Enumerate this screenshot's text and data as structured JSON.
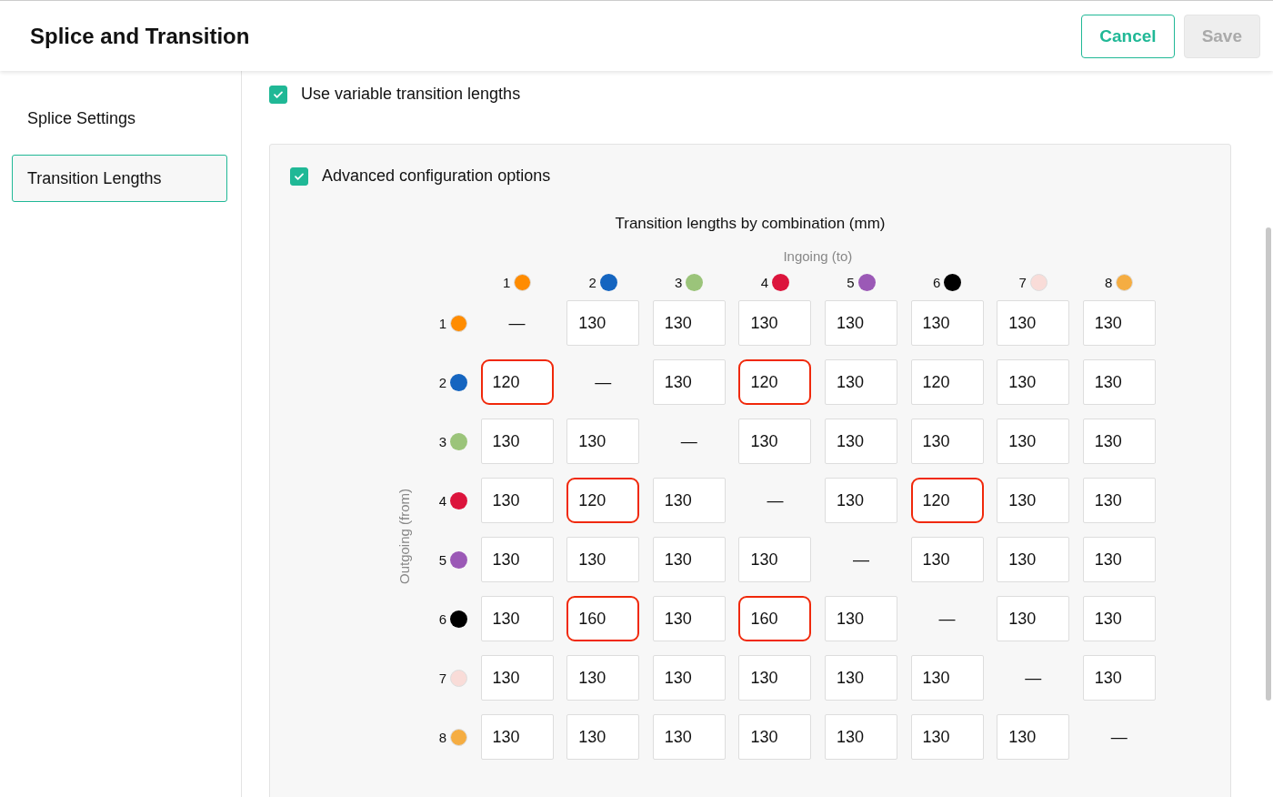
{
  "header": {
    "title": "Splice and Transition",
    "buttons": [
      {
        "label": "Cancel",
        "kind": "outline",
        "disabled": false
      },
      {
        "label": "Save",
        "kind": "primary",
        "disabled": true
      }
    ]
  },
  "sidebar": {
    "items": [
      {
        "label": "Splice Settings",
        "selected": false
      },
      {
        "label": "Transition Lengths",
        "selected": true
      }
    ]
  },
  "variable_lengths": {
    "label": "Use variable transition lengths",
    "checked": true
  },
  "advanced": {
    "label": "Advanced configuration options",
    "checked": true
  },
  "matrix": {
    "title": "Transition lengths by combination (mm)",
    "column_axis": "Ingoing (to)",
    "row_axis": "Outgoing (from)",
    "columns": [
      {
        "label": "1",
        "color": "#ff8c00"
      },
      {
        "label": "2",
        "color": "#1565c0"
      },
      {
        "label": "3",
        "color": "#9bc47a"
      },
      {
        "label": "4",
        "color": "#dc143c"
      },
      {
        "label": "5",
        "color": "#9b59b6"
      },
      {
        "label": "6",
        "color": "#000000"
      },
      {
        "label": "7",
        "color": "#f9dcd8"
      },
      {
        "label": "8",
        "color": "#f5ad42"
      }
    ],
    "rows": [
      {
        "label": "1",
        "color": "#ff8c00",
        "cells": [
          {
            "kind": "none",
            "text": "—"
          },
          {
            "kind": "input",
            "value": "130",
            "highlighted": false
          },
          {
            "kind": "input",
            "value": "130",
            "highlighted": false
          },
          {
            "kind": "input",
            "value": "130",
            "highlighted": false
          },
          {
            "kind": "input",
            "value": "130",
            "highlighted": false
          },
          {
            "kind": "input",
            "value": "130",
            "highlighted": false
          },
          {
            "kind": "input",
            "value": "130",
            "highlighted": false
          },
          {
            "kind": "input",
            "value": "130",
            "highlighted": false
          }
        ]
      },
      {
        "label": "2",
        "color": "#1565c0",
        "cells": [
          {
            "kind": "input",
            "value": "120",
            "highlighted": true
          },
          {
            "kind": "none",
            "text": "—"
          },
          {
            "kind": "input",
            "value": "130",
            "highlighted": false
          },
          {
            "kind": "input",
            "value": "120",
            "highlighted": true
          },
          {
            "kind": "input",
            "value": "130",
            "highlighted": false
          },
          {
            "kind": "input",
            "value": "120",
            "highlighted": false
          },
          {
            "kind": "input",
            "value": "130",
            "highlighted": false
          },
          {
            "kind": "input",
            "value": "130",
            "highlighted": false
          }
        ]
      },
      {
        "label": "3",
        "color": "#9bc47a",
        "cells": [
          {
            "kind": "input",
            "value": "130",
            "highlighted": false
          },
          {
            "kind": "input",
            "value": "130",
            "highlighted": false
          },
          {
            "kind": "none",
            "text": "—"
          },
          {
            "kind": "input",
            "value": "130",
            "highlighted": false
          },
          {
            "kind": "input",
            "value": "130",
            "highlighted": false
          },
          {
            "kind": "input",
            "value": "130",
            "highlighted": false
          },
          {
            "kind": "input",
            "value": "130",
            "highlighted": false
          },
          {
            "kind": "input",
            "value": "130",
            "highlighted": false
          }
        ]
      },
      {
        "label": "4",
        "color": "#dc143c",
        "cells": [
          {
            "kind": "input",
            "value": "130",
            "highlighted": false
          },
          {
            "kind": "input",
            "value": "120",
            "highlighted": true
          },
          {
            "kind": "input",
            "value": "130",
            "highlighted": false
          },
          {
            "kind": "none",
            "text": "—"
          },
          {
            "kind": "input",
            "value": "130",
            "highlighted": false
          },
          {
            "kind": "input",
            "value": "120",
            "highlighted": true
          },
          {
            "kind": "input",
            "value": "130",
            "highlighted": false
          },
          {
            "kind": "input",
            "value": "130",
            "highlighted": false
          }
        ]
      },
      {
        "label": "5",
        "color": "#9b59b6",
        "cells": [
          {
            "kind": "input",
            "value": "130",
            "highlighted": false
          },
          {
            "kind": "input",
            "value": "130",
            "highlighted": false
          },
          {
            "kind": "input",
            "value": "130",
            "highlighted": false
          },
          {
            "kind": "input",
            "value": "130",
            "highlighted": false
          },
          {
            "kind": "none",
            "text": "—"
          },
          {
            "kind": "input",
            "value": "130",
            "highlighted": false
          },
          {
            "kind": "input",
            "value": "130",
            "highlighted": false
          },
          {
            "kind": "input",
            "value": "130",
            "highlighted": false
          }
        ]
      },
      {
        "label": "6",
        "color": "#000000",
        "cells": [
          {
            "kind": "input",
            "value": "130",
            "highlighted": false
          },
          {
            "kind": "input",
            "value": "160",
            "highlighted": true
          },
          {
            "kind": "input",
            "value": "130",
            "highlighted": false
          },
          {
            "kind": "input",
            "value": "160",
            "highlighted": true
          },
          {
            "kind": "input",
            "value": "130",
            "highlighted": false
          },
          {
            "kind": "none",
            "text": "—"
          },
          {
            "kind": "input",
            "value": "130",
            "highlighted": false
          },
          {
            "kind": "input",
            "value": "130",
            "highlighted": false
          }
        ]
      },
      {
        "label": "7",
        "color": "#f9dcd8",
        "cells": [
          {
            "kind": "input",
            "value": "130",
            "highlighted": false
          },
          {
            "kind": "input",
            "value": "130",
            "highlighted": false
          },
          {
            "kind": "input",
            "value": "130",
            "highlighted": false
          },
          {
            "kind": "input",
            "value": "130",
            "highlighted": false
          },
          {
            "kind": "input",
            "value": "130",
            "highlighted": false
          },
          {
            "kind": "input",
            "value": "130",
            "highlighted": false
          },
          {
            "kind": "none",
            "text": "—"
          },
          {
            "kind": "input",
            "value": "130",
            "highlighted": false
          }
        ]
      },
      {
        "label": "8",
        "color": "#f5ad42",
        "cells": [
          {
            "kind": "input",
            "value": "130",
            "highlighted": false
          },
          {
            "kind": "input",
            "value": "130",
            "highlighted": false
          },
          {
            "kind": "input",
            "value": "130",
            "highlighted": false
          },
          {
            "kind": "input",
            "value": "130",
            "highlighted": false
          },
          {
            "kind": "input",
            "value": "130",
            "highlighted": false
          },
          {
            "kind": "input",
            "value": "130",
            "highlighted": false
          },
          {
            "kind": "input",
            "value": "130",
            "highlighted": false
          },
          {
            "kind": "none",
            "text": "—"
          }
        ]
      }
    ]
  }
}
